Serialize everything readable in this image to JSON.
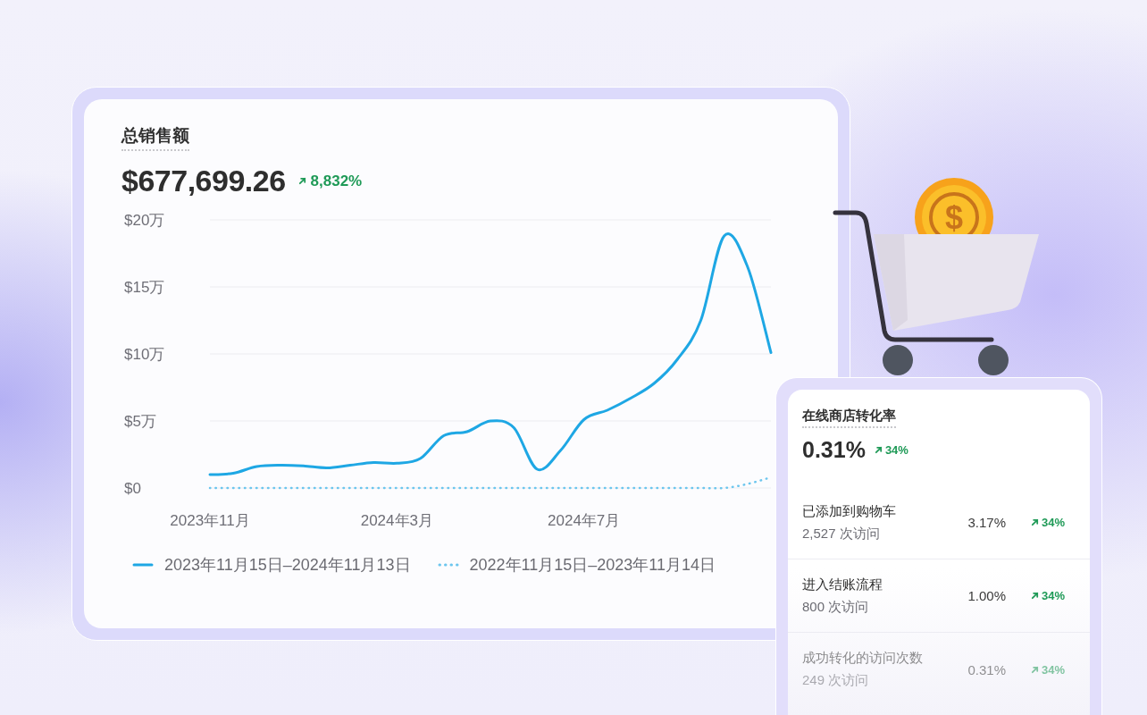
{
  "sales_card": {
    "title": "总销售额",
    "total": "$677,699.26",
    "change": "8,832%",
    "chart_data": {
      "type": "line",
      "categories": [
        "2023年11月",
        null,
        null,
        null,
        null,
        null,
        null,
        null,
        "2024年3月",
        null,
        null,
        null,
        null,
        null,
        null,
        null,
        "2024年7月",
        null,
        null,
        null,
        null,
        null,
        null,
        null,
        null
      ],
      "ylim": [
        0,
        20
      ],
      "grid": true,
      "yticks": [
        {
          "value": 0,
          "label": "$0"
        },
        {
          "value": 5,
          "label": "$5万"
        },
        {
          "value": 10,
          "label": "$10万"
        },
        {
          "value": 15,
          "label": "$15万"
        },
        {
          "value": 20,
          "label": "$20万"
        }
      ],
      "series": [
        {
          "name": "2023年11月15日–2024年11月13日",
          "color": "#1ea7e4",
          "line_style": "solid",
          "values": [
            1.0,
            1.1,
            1.6,
            1.7,
            1.65,
            1.5,
            1.7,
            1.9,
            1.85,
            2.2,
            3.9,
            4.2,
            5.0,
            4.5,
            1.4,
            2.8,
            5.1,
            5.8,
            6.7,
            7.8,
            9.6,
            12.5,
            18.8,
            16.5,
            10.1
          ]
        },
        {
          "name": "2022年11月15日–2023年11月14日",
          "color": "#6cc6ee",
          "line_style": "dotted",
          "values": [
            0,
            0,
            0,
            0,
            0,
            0,
            0,
            0,
            0,
            0,
            0,
            0,
            0,
            0,
            0,
            0,
            0,
            0,
            0,
            0,
            0,
            0,
            0,
            0.3,
            0.8
          ]
        }
      ]
    }
  },
  "cart_illustration": {
    "coin_symbol": "$"
  },
  "conversion_card": {
    "title": "在线商店转化率",
    "rate": "0.31%",
    "change": "34%",
    "rows": [
      {
        "label": "已添加到购物车",
        "visits": "2,527 次访问",
        "rate": "3.17%",
        "change": "34%"
      },
      {
        "label": "进入结账流程",
        "visits": "800 次访问",
        "rate": "1.00%",
        "change": "34%"
      },
      {
        "label": "成功转化的访问次数",
        "visits": "249 次访问",
        "rate": "0.31%",
        "change": "34%"
      }
    ]
  }
}
